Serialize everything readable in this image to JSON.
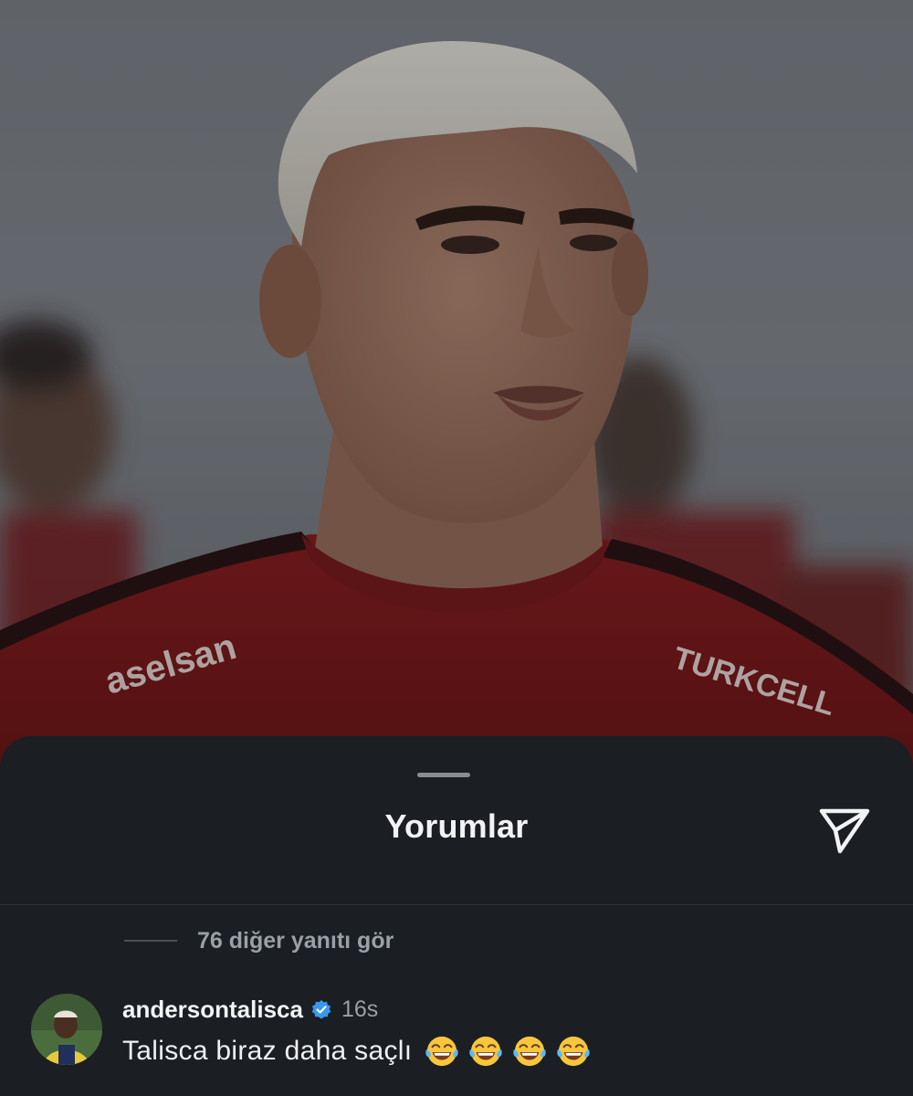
{
  "sheet": {
    "title": "Yorumlar",
    "share_icon": "send-icon"
  },
  "replies": {
    "more_label": "76 diğer yanıtı gör"
  },
  "comment": {
    "username": "andersontalisca",
    "verified_icon": "verified-badge-icon",
    "time": "16s",
    "text": "Talisca biraz daha saçlı",
    "emoji_icon": "face-with-tears-of-joy-icon",
    "emoji_count": 4
  },
  "photo": {
    "jersey_sponsor_left": "aselsan",
    "jersey_sponsor_right": "TURKCELL"
  },
  "colors": {
    "sheet_bg": "#1b1e22",
    "text_primary": "#f2f3f5",
    "text_secondary": "#9aa0a6",
    "verified": "#3897f0",
    "jersey_red": "#8a1f22"
  }
}
